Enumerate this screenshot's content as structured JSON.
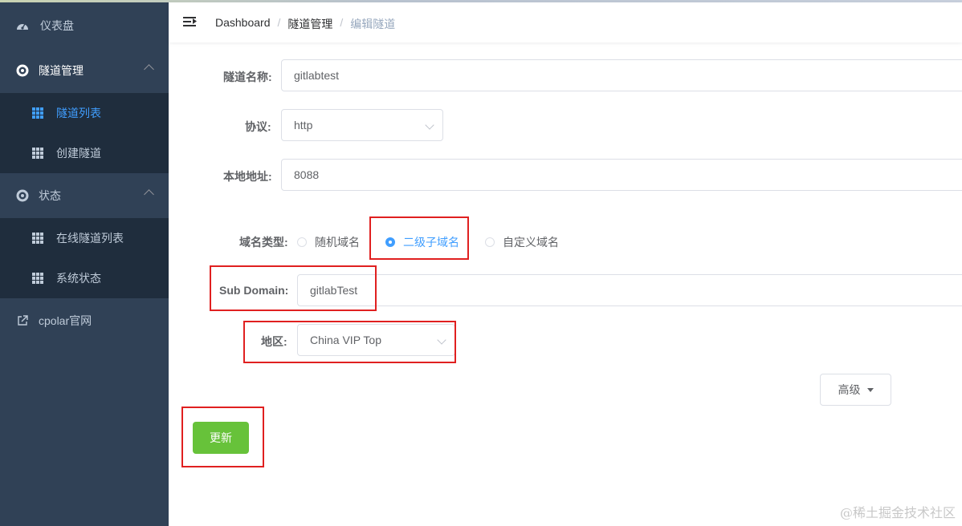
{
  "sidebar": {
    "dashboard": {
      "label": "仪表盘",
      "icon": "dashboard-icon"
    },
    "tunnel_mgmt": {
      "label": "隧道管理",
      "icon": "lifebuoy-icon"
    },
    "tunnel_list": {
      "label": "隧道列表",
      "icon": "table-icon"
    },
    "create_tunnel": {
      "label": "创建隧道",
      "icon": "table-icon"
    },
    "status": {
      "label": "状态",
      "icon": "lifebuoy-icon"
    },
    "online_tunnels": {
      "label": "在线隧道列表",
      "icon": "table-icon"
    },
    "system_status": {
      "label": "系统状态",
      "icon": "table-icon"
    },
    "cpolar_site": {
      "label": "cpolar官网",
      "icon": "external-link-icon"
    }
  },
  "header": {
    "breadcrumb": [
      "Dashboard",
      "隧道管理",
      "编辑隧道"
    ],
    "separator": "/"
  },
  "form": {
    "tunnel_name": {
      "label": "隧道名称:",
      "value": "gitlabtest"
    },
    "protocol": {
      "label": "协议:",
      "value": "http"
    },
    "local_addr": {
      "label": "本地地址:",
      "value": "8088"
    },
    "domain_type": {
      "label": "域名类型:",
      "options": [
        "随机域名",
        "二级子域名",
        "自定义域名"
      ],
      "selected": "二级子域名"
    },
    "sub_domain": {
      "label": "Sub Domain:",
      "value": "gitlabTest"
    },
    "region": {
      "label": "地区:",
      "value": "China VIP Top"
    },
    "advanced_label": "高级",
    "update_label": "更新"
  },
  "watermark": "@稀土掘金技术社区",
  "colors": {
    "sidebar_bg": "#304156",
    "submenu_bg": "#1f2d3d",
    "active": "#409eff",
    "update_button": "#67c23a",
    "highlight_box": "#e02020"
  }
}
